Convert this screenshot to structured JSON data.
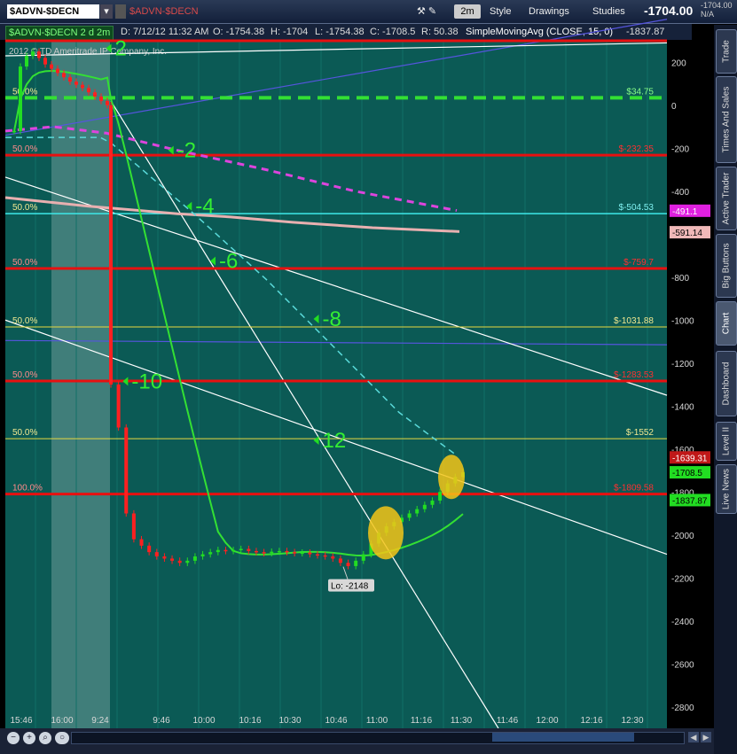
{
  "toolbar": {
    "symbol": "$ADVN-$DECN",
    "symbol_echo": "$ADVN-$DECN",
    "aggregation": "2m",
    "style_label": "Style",
    "drawings_label": "Drawings",
    "studies_label": "Studies",
    "last_price": "-1704.00",
    "net_change": "-1704.00",
    "net_change_pct": "N/A"
  },
  "info_bar": {
    "symbol_period": "$ADVN-$DECN 2 d 2m",
    "date": "D: 7/12/12 11:32 AM",
    "open": "O: -1754.38",
    "high": "H: -1704",
    "low": "L: -1754.38",
    "close": "C: -1708.5",
    "range": "R: 50.38",
    "sma_label": "SimpleMovingAvg (CLOSE, 15, 0)",
    "sma_value": "-1837.87"
  },
  "copyright": "2012 © TD Ameritrade IP Company, Inc.",
  "colors": {
    "background": "#0b5a55",
    "up_bar": "#22dd22",
    "down_bar": "#ff2020",
    "sma": "#33e033",
    "fib_red": "#e81010",
    "fib_yellow": "#e8d840",
    "fib_cyan": "#3ee8e8",
    "green_dash": "#33e033",
    "magenta_dash": "#dd44dd",
    "cyan_dash": "#5adada",
    "trendline": "#ffffff",
    "blue_line": "#5555dd",
    "pink_curve": "#e8b0b0",
    "highlight": "#f5c518"
  },
  "chart_data": {
    "type": "candlestick",
    "symbol": "$ADVN-$DECN",
    "interval": "2m",
    "ylim": [
      -2900,
      300
    ],
    "y_ticks": [
      200,
      0,
      -200,
      -400,
      -600,
      -800,
      -1000,
      -1200,
      -1400,
      -1600,
      -1800,
      -2000,
      -2200,
      -2400,
      -2600,
      -2800
    ],
    "x_ticks": [
      "15:46",
      "16:00",
      "9:24",
      "9:46",
      "10:00",
      "10:16",
      "10:30",
      "10:46",
      "11:00",
      "11:16",
      "11:30",
      "11:46",
      "12:00",
      "12:16",
      "12:30"
    ],
    "fib_levels": [
      {
        "pct": "",
        "label": "",
        "value": 300,
        "color": "red"
      },
      {
        "pct": "50.0%",
        "label": "$34.75",
        "value": 34.75,
        "color": "green_dash"
      },
      {
        "pct": "50.0%",
        "label": "$-232.35",
        "value": -232.35,
        "color": "red"
      },
      {
        "pct": "50.0%",
        "label": "$-504.53",
        "value": -504.53,
        "color": "cyan"
      },
      {
        "pct": "50.0%",
        "label": "$-759.7",
        "value": -759.7,
        "color": "red"
      },
      {
        "pct": "50.0%",
        "label": "$-1031.88",
        "value": -1031.88,
        "color": "yellow"
      },
      {
        "pct": "50.0%",
        "label": "$-1283.53",
        "value": -1283.53,
        "color": "red"
      },
      {
        "pct": "50.0%",
        "label": "$-1552",
        "value": -1552,
        "color": "yellow"
      },
      {
        "pct": "100.0%",
        "label": "$-1809.58",
        "value": -1809.58,
        "color": "red"
      }
    ],
    "price_bubbles": [
      {
        "label": "-491.1",
        "value": -491.1,
        "bg": "#e020e0",
        "fg": "#ffffff"
      },
      {
        "label": "-591.14",
        "value": -591.14,
        "bg": "#f0b8b8",
        "fg": "#000000"
      },
      {
        "label": "-1639.31",
        "value": -1639.31,
        "bg": "#c01818",
        "fg": "#ffffff"
      },
      {
        "label": "-1708.5",
        "value": -1708.5,
        "bg": "#22dd22",
        "fg": "#000000"
      },
      {
        "label": "-1837.87",
        "value": -1837.87,
        "bg": "#22dd22",
        "fg": "#000000"
      }
    ],
    "annotations": [
      {
        "text": "2",
        "time": "9:28",
        "value": 265
      },
      {
        "text": "-2",
        "time": "9:50",
        "value": -210
      },
      {
        "text": "-4",
        "time": "9:56",
        "value": -470
      },
      {
        "text": "-6",
        "time": "10:04",
        "value": -725
      },
      {
        "text": "-8",
        "time": "10:40",
        "value": -995
      },
      {
        "text": "-10",
        "time": "9:34",
        "value": -1285
      },
      {
        "text": "12",
        "time": "10:40",
        "value": -1560
      }
    ],
    "low_label": "Lo: -2148",
    "low_value": -2148,
    "sma_period": 15,
    "series": [
      {
        "name": "$ADVN-$DECN",
        "note": "approximate 2-minute closes",
        "close": [
          -120,
          180,
          230,
          250,
          220,
          190,
          170,
          150,
          130,
          110,
          95,
          80,
          60,
          40,
          20,
          0,
          -1300,
          -1500,
          -1900,
          -2020,
          -2050,
          -2080,
          -2100,
          -2110,
          -2120,
          -2130,
          -2120,
          -2100,
          -2090,
          -2080,
          -2070,
          -2075,
          -2070,
          -2065,
          -2075,
          -2080,
          -2085,
          -2078,
          -2075,
          -2080,
          -2085,
          -2082,
          -2090,
          -2095,
          -2100,
          -2110,
          -2130,
          -2145,
          -2120,
          -2090,
          -2040,
          -1990,
          -1960,
          -1940,
          -1920,
          -1900,
          -1880,
          -1860,
          -1840,
          -1800,
          -1760,
          -1730,
          -1708.5
        ]
      }
    ]
  },
  "side_tabs": [
    "Trade",
    "Times And Sales",
    "Active Trader",
    "Big Buttons",
    "Chart",
    "Dashboard",
    "Level II",
    "Live News"
  ],
  "side_tabs_active": "Chart"
}
